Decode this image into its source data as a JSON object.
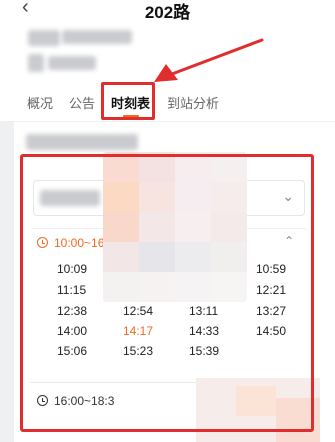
{
  "header": {
    "back_icon": "chevron-left-icon",
    "title": "202路"
  },
  "tabs": [
    {
      "label": "概况",
      "active": false
    },
    {
      "label": "公告",
      "active": false
    },
    {
      "label": "时刻表",
      "active": true
    },
    {
      "label": "到站分析",
      "active": false
    }
  ],
  "colors": {
    "accent": "#f06a21",
    "highlight_box": "#e02d2d"
  },
  "timetable": {
    "dropdown_icon": "chevron-down-icon",
    "periods": [
      {
        "range": "10:00~16",
        "expanded": true,
        "collapse_icon": "chevron-up-icon",
        "times": {
          "col1": [
            "10:09",
            "11:15",
            "12:38",
            "14:00",
            "15:06"
          ],
          "col2": [
            "12:54",
            "14:17",
            "15:23"
          ],
          "col3": [
            "13:11",
            "14:33",
            "15:39"
          ],
          "col4": [
            "10:59",
            "12:21",
            "13:27",
            "14:50"
          ]
        },
        "current_time": "14:17"
      },
      {
        "range": "16:00~18:3",
        "expanded": false
      }
    ]
  }
}
